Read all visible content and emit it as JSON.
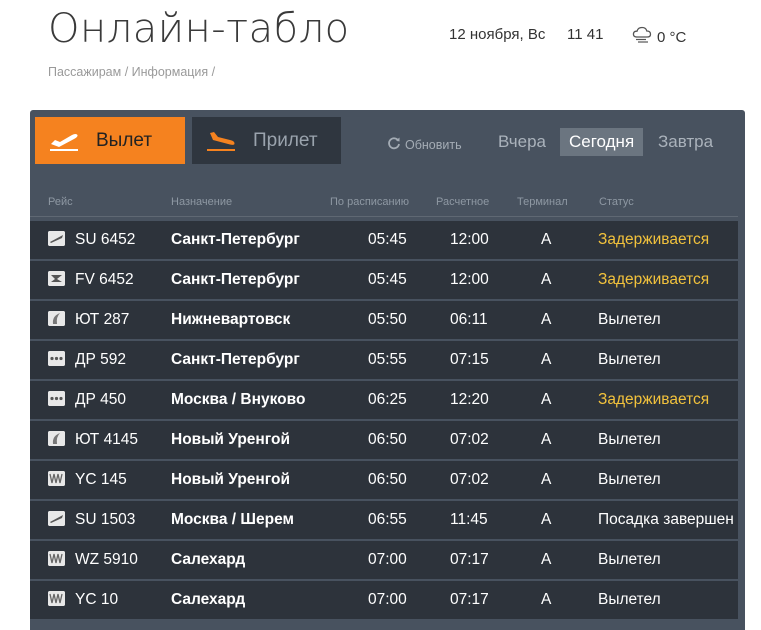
{
  "header": {
    "title": "Онлайн-табло",
    "date": "12 ноября, Вс",
    "time": "11  41",
    "temperature": "0 °C",
    "weather_icon": "cloud-rain-icon"
  },
  "breadcrumb": [
    "Пассажирам",
    "Информация"
  ],
  "tabs": {
    "departure": "Вылет",
    "arrival": "Прилет",
    "active": "departure",
    "active_color": "#f5821f"
  },
  "controls": {
    "refresh": "Обновить",
    "days": [
      "Вчера",
      "Сегодня",
      "Завтра"
    ],
    "active_day": "Сегодня"
  },
  "table": {
    "headers": {
      "flight": "Рейс",
      "destination": "Назначение",
      "scheduled": "По расписанию",
      "estimated": "Расчетное",
      "terminal": "Терминал",
      "status": "Статус"
    },
    "rows": [
      {
        "logo": "aeroflot",
        "flight": "SU 6452",
        "destination": "Санкт-Петербург",
        "scheduled": "05:45",
        "estimated": "12:00",
        "terminal": "A",
        "status": "Задерживается",
        "delayed": true
      },
      {
        "logo": "rossiya",
        "flight": "FV 6452",
        "destination": "Санкт-Петербург",
        "scheduled": "05:45",
        "estimated": "12:00",
        "terminal": "A",
        "status": "Задерживается",
        "delayed": true
      },
      {
        "logo": "utair",
        "flight": "ЮТ 287",
        "destination": "Нижневартовск",
        "scheduled": "05:50",
        "estimated": "06:11",
        "terminal": "A",
        "status": "Вылетел",
        "delayed": false
      },
      {
        "logo": "dp",
        "flight": "ДР 592",
        "destination": "Санкт-Петербург",
        "scheduled": "05:55",
        "estimated": "07:15",
        "terminal": "A",
        "status": "Вылетел",
        "delayed": false
      },
      {
        "logo": "dp",
        "flight": "ДР 450",
        "destination": "Москва / Внуково",
        "scheduled": "06:25",
        "estimated": "12:20",
        "terminal": "A",
        "status": "Задерживается",
        "delayed": true
      },
      {
        "logo": "utair",
        "flight": "ЮТ 4145",
        "destination": "Новый Уренгой",
        "scheduled": "06:50",
        "estimated": "07:02",
        "terminal": "A",
        "status": "Вылетел",
        "delayed": false
      },
      {
        "logo": "yamal",
        "flight": "YC 145",
        "destination": "Новый Уренгой",
        "scheduled": "06:50",
        "estimated": "07:02",
        "terminal": "A",
        "status": "Вылетел",
        "delayed": false
      },
      {
        "logo": "aeroflot",
        "flight": "SU 1503",
        "destination": "Москва / Шерем",
        "scheduled": "06:55",
        "estimated": "11:45",
        "terminal": "A",
        "status": "Посадка завершен",
        "delayed": false
      },
      {
        "logo": "yamal",
        "flight": "WZ 5910",
        "destination": "Салехард",
        "scheduled": "07:00",
        "estimated": "07:17",
        "terminal": "A",
        "status": "Вылетел",
        "delayed": false
      },
      {
        "logo": "yamal",
        "flight": "YC 10",
        "destination": "Салехард",
        "scheduled": "07:00",
        "estimated": "07:17",
        "terminal": "A",
        "status": "Вылетел",
        "delayed": false
      }
    ]
  }
}
